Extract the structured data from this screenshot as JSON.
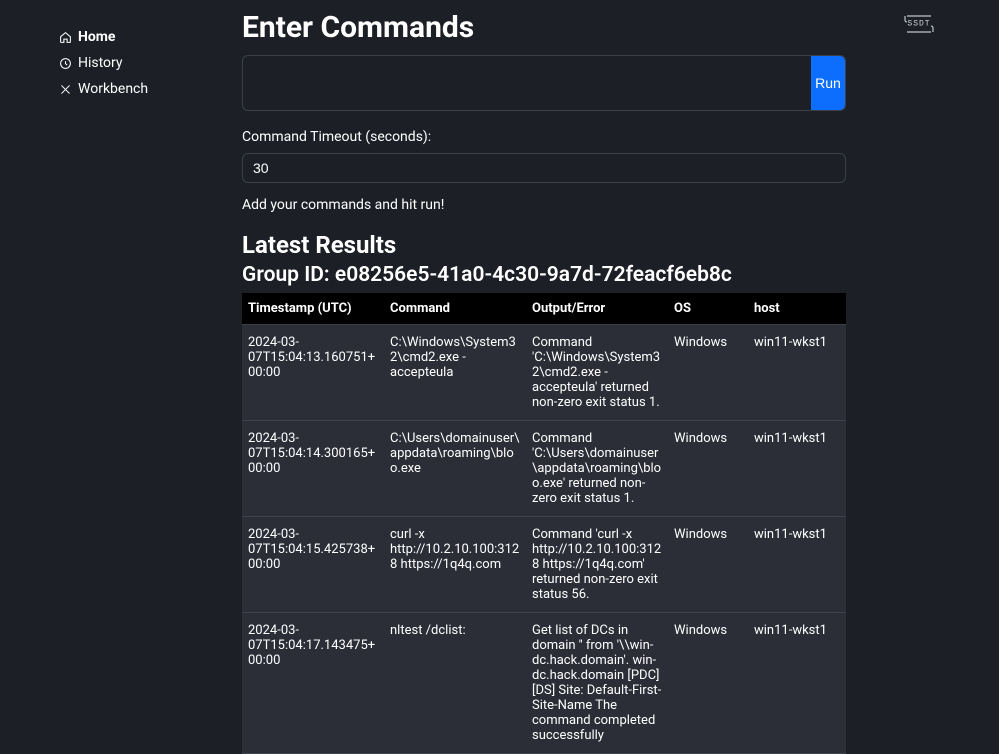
{
  "sidebar": {
    "items": [
      {
        "label": "Home",
        "icon": "home-icon",
        "active": true
      },
      {
        "label": "History",
        "icon": "clock-icon",
        "active": false
      },
      {
        "label": "Workbench",
        "icon": "tools-icon",
        "active": false
      }
    ]
  },
  "header": {
    "title": "Enter Commands",
    "run_label": "Run",
    "timeout_label": "Command Timeout (seconds):",
    "timeout_value": "30",
    "hint": "Add your commands and hit run!"
  },
  "results": {
    "title": "Latest Results",
    "group_prefix": "Group ID: ",
    "group_id": "e08256e5-41a0-4c30-9a7d-72feacf6eb8c",
    "columns": {
      "timestamp": "Timestamp (UTC)",
      "command": "Command",
      "output": "Output/Error",
      "os": "OS",
      "host": "host"
    },
    "rows": [
      {
        "timestamp": "2024-03-07T15:04:13.160751+00:00",
        "command": "C:\\Windows\\System32\\cmd2.exe -accepteula",
        "output": "Command 'C:\\Windows\\System32\\cmd2.exe -accepteula' returned non-zero exit status 1.",
        "os": "Windows",
        "host": "win11-wkst1"
      },
      {
        "timestamp": "2024-03-07T15:04:14.300165+00:00",
        "command": "C:\\Users\\domainuser\\appdata\\roaming\\bloo.exe",
        "output": "Command 'C:\\Users\\domainuser\\appdata\\roaming\\bloo.exe' returned non-zero exit status 1.",
        "os": "Windows",
        "host": "win11-wkst1"
      },
      {
        "timestamp": "2024-03-07T15:04:15.425738+00:00",
        "command": "curl -x http://10.2.10.100:3128 https://1q4q.com",
        "output": "Command 'curl -x http://10.2.10.100:3128 https://1q4q.com' returned non-zero exit status 56.",
        "os": "Windows",
        "host": "win11-wkst1"
      },
      {
        "timestamp": "2024-03-07T15:04:17.143475+00:00",
        "command": "nltest /dclist:",
        "output": "Get list of DCs in domain '' from '\\\\win-dc.hack.domain'. win-dc.hack.domain [PDC] [DS] Site: Default-First-Site-Name The command completed successfully",
        "os": "Windows",
        "host": "win11-wkst1"
      }
    ]
  },
  "logo": {
    "text": "SSDT"
  }
}
